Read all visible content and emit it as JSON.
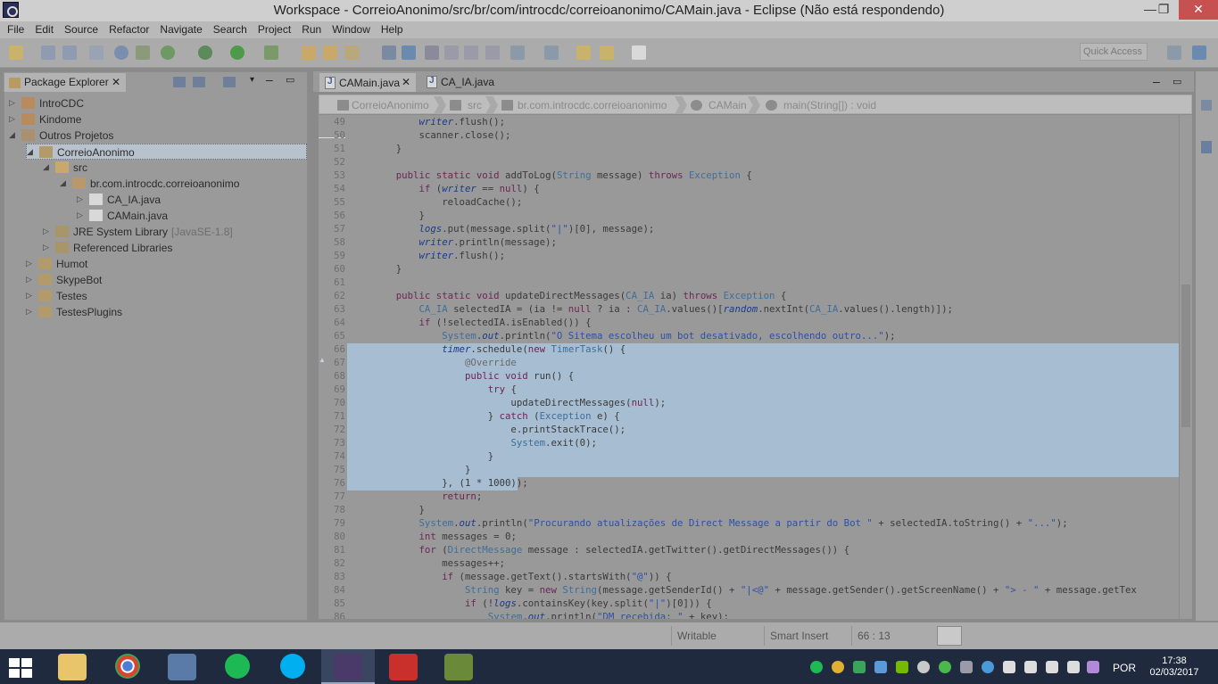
{
  "window": {
    "title": "Workspace - CorreioAnonimo/src/br/com/introcdc/correioanonimo/CAMain.java - Eclipse (Não está respondendo)"
  },
  "menu": [
    "File",
    "Edit",
    "Source",
    "Refactor",
    "Navigate",
    "Search",
    "Project",
    "Run",
    "Window",
    "Help"
  ],
  "toolbar": {
    "quick_access_placeholder": "Quick Access"
  },
  "package_explorer": {
    "tab_label": "Package Explorer",
    "tree": [
      {
        "label": "IntroCDC",
        "decoration": "",
        "twisty": "▷",
        "depth": 0,
        "icon": "project-icon"
      },
      {
        "label": "Kindome",
        "decoration": "",
        "twisty": "▷",
        "depth": 0,
        "icon": "project-icon"
      },
      {
        "label": "Outros Projetos",
        "decoration": "",
        "twisty": "◢",
        "depth": 0,
        "icon": "working-set-icon"
      },
      {
        "label": "CorreioAnonimo",
        "decoration": "",
        "twisty": "◢",
        "depth": 1,
        "icon": "java-project-icon",
        "selected": true
      },
      {
        "label": "src",
        "decoration": "",
        "twisty": "◢",
        "depth": 2,
        "icon": "source-folder-icon"
      },
      {
        "label": "br.com.introcdc.correioanonimo",
        "decoration": "",
        "twisty": "◢",
        "depth": 3,
        "icon": "package-icon"
      },
      {
        "label": "CA_IA.java",
        "decoration": "",
        "twisty": "▷",
        "depth": 4,
        "icon": "java-file-icon"
      },
      {
        "label": "CAMain.java",
        "decoration": "",
        "twisty": "▷",
        "depth": 4,
        "icon": "java-file-icon"
      },
      {
        "label": "JRE System Library",
        "decoration": "[JavaSE-1.8]",
        "twisty": "▷",
        "depth": 2,
        "icon": "library-icon"
      },
      {
        "label": "Referenced Libraries",
        "decoration": "",
        "twisty": "▷",
        "depth": 2,
        "icon": "library-icon"
      },
      {
        "label": "Humot",
        "decoration": "",
        "twisty": "▷",
        "depth": 1,
        "icon": "java-project-icon"
      },
      {
        "label": "SkypeBot",
        "decoration": "",
        "twisty": "▷",
        "depth": 1,
        "icon": "java-project-icon"
      },
      {
        "label": "Testes",
        "decoration": "",
        "twisty": "▷",
        "depth": 1,
        "icon": "java-project-icon"
      },
      {
        "label": "TestesPlugins",
        "decoration": "",
        "twisty": "▷",
        "depth": 1,
        "icon": "java-project-icon"
      }
    ]
  },
  "editor": {
    "tabs": [
      {
        "label": "CAMain.java",
        "active": true
      },
      {
        "label": "CA_IA.java",
        "active": false
      }
    ],
    "breadcrumb": [
      "CorreioAnonimo",
      "src",
      "br.com.introcdc.correioanonimo",
      "CAMain",
      "main(String[]) : void"
    ],
    "lines": [
      {
        "n": "49",
        "code": "        writer.flush();"
      },
      {
        "n": "50",
        "code": "        scanner.close();"
      },
      {
        "n": "51",
        "code": "    }"
      },
      {
        "n": "52",
        "code": ""
      },
      {
        "n": "53",
        "code": "    public static void addToLog(String message) throws Exception {"
      },
      {
        "n": "54",
        "code": "        if (writer == null) {"
      },
      {
        "n": "55",
        "code": "            reloadCache();"
      },
      {
        "n": "56",
        "code": "        }"
      },
      {
        "n": "57",
        "code": "        logs.put(message.split(\"|\")[0], message);"
      },
      {
        "n": "58",
        "code": "        writer.println(message);"
      },
      {
        "n": "59",
        "code": "        writer.flush();"
      },
      {
        "n": "60",
        "code": "    }"
      },
      {
        "n": "61",
        "code": ""
      },
      {
        "n": "62",
        "code": "    public static void updateDirectMessages(CA_IA ia) throws Exception {"
      },
      {
        "n": "63",
        "code": "        CA_IA selectedIA = (ia != null ? ia : CA_IA.values()[random.nextInt(CA_IA.values().length)]);"
      },
      {
        "n": "64",
        "code": "        if (!selectedIA.isEnabled()) {"
      },
      {
        "n": "65",
        "code": "            System.out.println(\"O Sitema escolheu um bot desativado, escolhendo outro...\");"
      },
      {
        "n": "66",
        "code": "            timer.schedule(new TimerTask() {"
      },
      {
        "n": "67",
        "code": "                @Override"
      },
      {
        "n": "68",
        "code": "                public void run() {"
      },
      {
        "n": "69",
        "code": "                    try {"
      },
      {
        "n": "70",
        "code": "                        updateDirectMessages(null);"
      },
      {
        "n": "71",
        "code": "                    } catch (Exception e) {"
      },
      {
        "n": "72",
        "code": "                        e.printStackTrace();"
      },
      {
        "n": "73",
        "code": "                        System.exit(0);"
      },
      {
        "n": "74",
        "code": "                    }"
      },
      {
        "n": "75",
        "code": "                }"
      },
      {
        "n": "76",
        "code": "            }, (1 * 1000));"
      },
      {
        "n": "77",
        "code": "            return;"
      },
      {
        "n": "78",
        "code": "        }"
      },
      {
        "n": "79",
        "code": "        System.out.println(\"Procurando atualizações de Direct Message a partir do Bot \" + selectedIA.toString() + \"...\");"
      },
      {
        "n": "80",
        "code": "        int messages = 0;"
      },
      {
        "n": "81",
        "code": "        for (DirectMessage message : selectedIA.getTwitter().getDirectMessages()) {"
      },
      {
        "n": "82",
        "code": "            messages++;"
      },
      {
        "n": "83",
        "code": "            if (message.getText().startsWith(\"@\")) {"
      },
      {
        "n": "84",
        "code": "                String key = new String(message.getSenderId() + \"|<@\" + message.getSender().getScreenName() + \"> - \" + message.getTex"
      },
      {
        "n": "85",
        "code": "                if (!logs.containsKey(key.split(\"|\")[0])) {"
      },
      {
        "n": "86",
        "code": "                    System.out.println(\"DM recebida: \" + key);"
      }
    ]
  },
  "status": {
    "writable": "Writable",
    "insert_mode": "Smart Insert",
    "cursor": "66 : 13"
  },
  "taskbar": {
    "language": "POR",
    "time": "17:38",
    "date": "02/03/2017"
  },
  "colors": {
    "selection": "#a7bdd1",
    "keyword": "#6d2656",
    "taskbar": "#1f2a3e"
  }
}
